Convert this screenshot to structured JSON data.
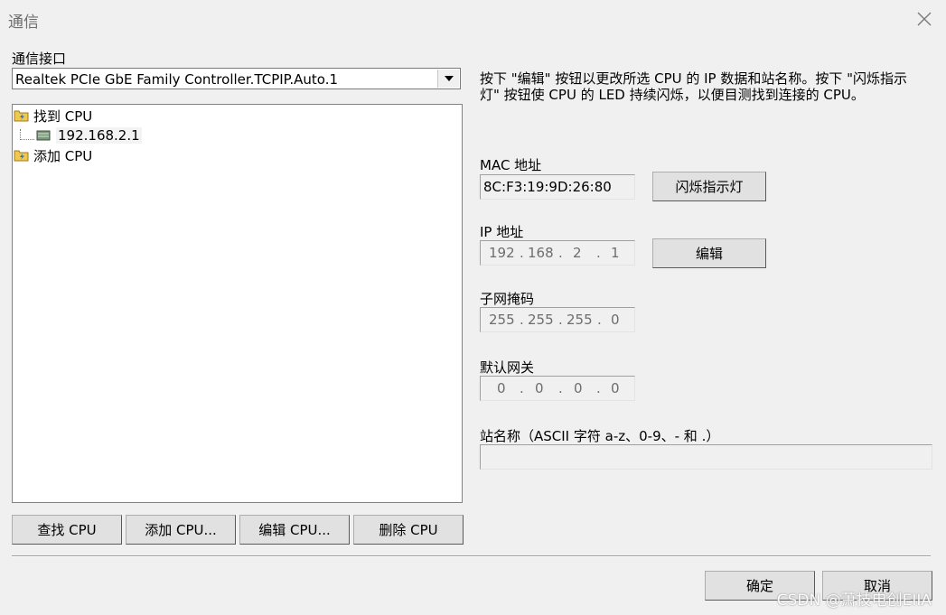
{
  "window": {
    "title": "通信"
  },
  "interface": {
    "label": "通信接口",
    "selected": "Realtek PCIe GbE Family Controller.TCPIP.Auto.1"
  },
  "tree": {
    "found_cpu": "找到 CPU",
    "device_ip": "192.168.2.1",
    "add_cpu": "添加 CPU"
  },
  "buttons": {
    "find_cpu": "查找 CPU",
    "add_cpu": "添加 CPU...",
    "edit_cpu": "编辑 CPU...",
    "delete_cpu": "删除 CPU",
    "flash_led": "闪烁指示灯",
    "edit": "编辑",
    "ok": "确定",
    "cancel": "取消"
  },
  "info_text": "按下 \"编辑\" 按钮以更改所选 CPU 的 IP 数据和站名称。按下 \"闪烁指示灯\" 按钮使 CPU 的 LED 持续闪烁，以便目测找到连接的 CPU。",
  "mac": {
    "label": "MAC 地址",
    "value": "8C:F3:19:9D:26:80"
  },
  "ip": {
    "label": "IP 地址",
    "octets": [
      "192",
      "168",
      "2",
      "1"
    ]
  },
  "subnet": {
    "label": "子网掩码",
    "octets": [
      "255",
      "255",
      "255",
      "0"
    ]
  },
  "gateway": {
    "label": "默认网关",
    "octets": [
      "0",
      "0",
      "0",
      "0"
    ]
  },
  "station_name": {
    "label": "站名称（ASCII 字符 a-z、0-9、- 和 .）",
    "value": ""
  },
  "watermark": "CSDN @萧技电创EIIA"
}
